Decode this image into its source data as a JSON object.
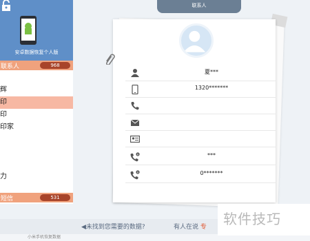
{
  "app": {
    "banner_title": "安卓数据恢复个人版",
    "title": "联系人"
  },
  "sidebar": {
    "contacts_label": "联系人",
    "contacts_count": "968",
    "sms_label": "短信",
    "sms_count": "531",
    "contacts": [
      "",
      "辉",
      "印",
      "印",
      "印家",
      "",
      "",
      "",
      "力"
    ],
    "selected_index": 2
  },
  "contact_detail": {
    "name": "夏***",
    "phone": "1320*******",
    "tel": "",
    "email": "",
    "address": "",
    "extra1": "***",
    "extra2": "0*******",
    "icons": [
      "person-icon",
      "mobile-icon",
      "phone-icon",
      "email-icon",
      "contact-card-icon",
      "phone-info-icon",
      "phone-info-icon"
    ]
  },
  "bottom": {
    "notfound_text": "未找到您需要的数据?",
    "help_text": "有人在说",
    "help_highlight": "专",
    "row_text": "小米手机恢复数据"
  },
  "watermark": "软件技巧",
  "colors": {
    "banner": "#5f8fc8",
    "section_header": "#f0a27d",
    "badge": "#a8442a",
    "selected_row": "#f7b8a3",
    "title_pill": "#6b7f94"
  }
}
